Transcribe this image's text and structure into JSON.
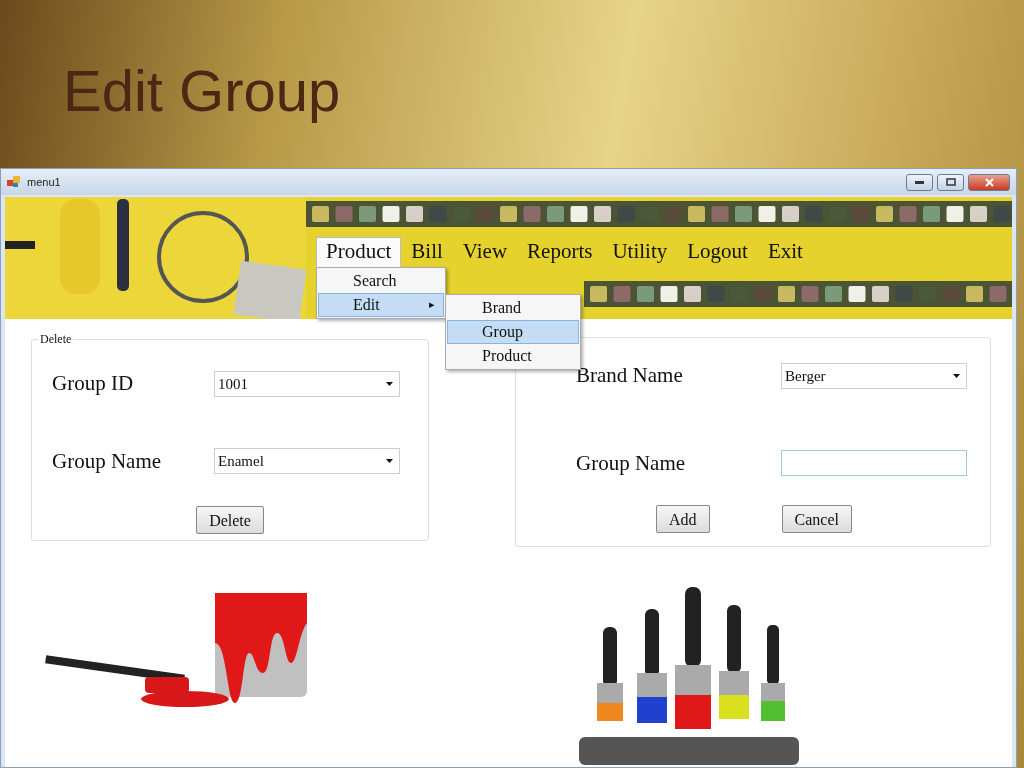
{
  "slide_title": "Edit Group",
  "window": {
    "title": "menu1"
  },
  "menu_bar": [
    {
      "label": "Product",
      "selected": true
    },
    {
      "label": "Bill",
      "selected": false
    },
    {
      "label": "View",
      "selected": false
    },
    {
      "label": "Reports",
      "selected": false
    },
    {
      "label": "Utility",
      "selected": false
    },
    {
      "label": "Logout",
      "selected": false
    },
    {
      "label": "Exit",
      "selected": false
    }
  ],
  "product_menu": [
    {
      "label": "Search",
      "selected": false
    },
    {
      "label": "Edit",
      "selected": true,
      "arrow": "▸"
    }
  ],
  "edit_submenu": [
    {
      "label": "Brand",
      "selected": false
    },
    {
      "label": "Group",
      "selected": true
    },
    {
      "label": "Product",
      "selected": false
    }
  ],
  "delete_group": {
    "title": "Delete",
    "fields": [
      {
        "label": "Group ID",
        "kind": "dropdown",
        "value": "1001"
      },
      {
        "label": "Group Name",
        "kind": "dropdown",
        "value": "Enamel"
      }
    ],
    "buttons": [
      "Delete"
    ]
  },
  "add_group": {
    "fields": [
      {
        "label": "Brand Name",
        "kind": "dropdown",
        "value": "Berger"
      },
      {
        "label": "Group Name",
        "kind": "text"
      }
    ],
    "buttons": [
      "Add",
      "Cancel"
    ]
  }
}
